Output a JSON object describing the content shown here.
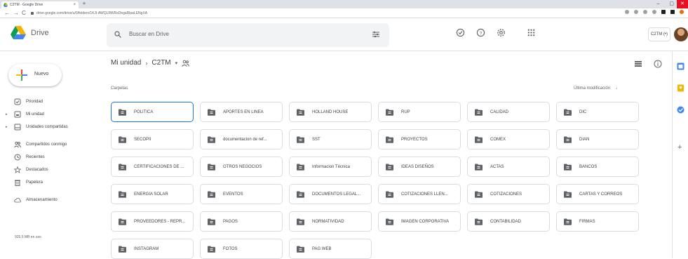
{
  "browser": {
    "tab_title": "C2TM - Google Drive",
    "tab_close": "×",
    "new_tab": "+",
    "url": "drive.google.com/drive/u/0/folders/1KJl-AWQLRWRsDegaRlpaLENgXA",
    "win_min": "–",
    "win_max": "▢",
    "win_close": "✕"
  },
  "header": {
    "brand": "Drive",
    "search_placeholder": "Buscar en Drive",
    "account_label": "C2TM (•)"
  },
  "sidebar": {
    "new_label": "Nuevo",
    "items": [
      {
        "label": "Prioridad",
        "icon": "priority-icon"
      },
      {
        "label": "Mi unidad",
        "icon": "my-drive-icon",
        "arrow": "▸"
      },
      {
        "label": "Unidades compartidas",
        "icon": "shared-drives-icon",
        "arrow": "▸"
      },
      {
        "label": "Compartidos conmigo",
        "icon": "shared-with-me-icon"
      },
      {
        "label": "Recientes",
        "icon": "clock-icon"
      },
      {
        "label": "Destacados",
        "icon": "star-icon"
      },
      {
        "label": "Papelera",
        "icon": "trash-icon"
      },
      {
        "label": "Almacenamiento",
        "icon": "cloud-icon"
      }
    ],
    "storage_used": "925.5 MB en uso"
  },
  "breadcrumb": {
    "root": "Mi unidad",
    "separator": "›",
    "current": "C2TM",
    "caret": "▾"
  },
  "content": {
    "section_label": "Carpetas",
    "sort_label": "Última modificación",
    "sort_arrow": "↓",
    "folders": [
      "POLITICA",
      "APORTES EN LINEA",
      "HOLLAND HOUSE",
      "RUP",
      "CALIDAD",
      "DIC",
      "SECOPII",
      "documentacion de ref...",
      "SST",
      "PROYECTOS",
      "COMEX",
      "DIAN",
      "CERTIFICACIONES DE ...",
      "OTROS NEGOCIOS",
      "Informacion Técnica",
      "IDEAS DISEÑOS",
      "ACTAS",
      "BANCOS",
      "ENERGIA SOLAR",
      "EVENTOS",
      "DOCUMENTOS LEGAL...",
      "COTIZACIONES LLEN...",
      "COTIZACIONES",
      "CARTAS Y CORREOS",
      "PROVEEDORES - REPR...",
      "PAGOS",
      "NORMATIVIDAD",
      "IMAGEN CORPORATIVA",
      "CONTABILIDAD",
      "FIRMAS",
      "INSTAGRAM",
      "FOTOS",
      "PAG WEB"
    ]
  },
  "side_panel": {
    "add": "+"
  },
  "colors": {
    "accent": "#1a73e8",
    "folder_icon": "#5f6368",
    "drive_green": "#0f9d58",
    "drive_yellow": "#f4b400",
    "drive_blue": "#4285f4"
  }
}
